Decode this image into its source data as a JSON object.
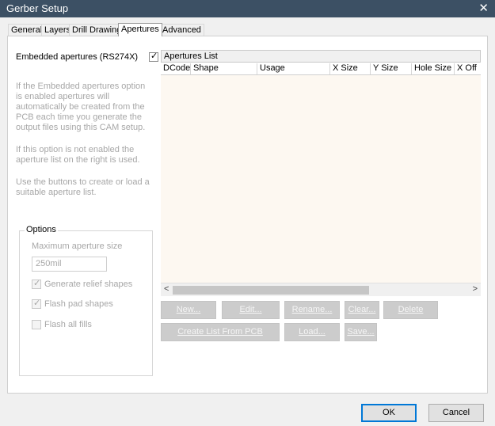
{
  "window": {
    "title": "Gerber Setup",
    "close_glyph": "✕"
  },
  "tabs": [
    {
      "label": "General"
    },
    {
      "label": "Layers"
    },
    {
      "label": "Drill Drawing"
    },
    {
      "label": "Apertures",
      "active": true
    },
    {
      "label": "Advanced"
    }
  ],
  "embedded": {
    "label": "Embedded apertures (RS274X)",
    "checked": true,
    "check_glyph": "✓"
  },
  "description": {
    "p1": "If the Embedded apertures option is enabled apertures will automatically be created from the PCB each time you generate the output files using this CAM setup.",
    "p2": "If this option is not enabled the aperture list on the right is used.",
    "p3": "Use the buttons to create or load a suitable aperture list."
  },
  "options": {
    "legend": "Options",
    "max_aperture_label": "Maximum aperture size",
    "max_aperture_value": "250mil",
    "generate_relief": {
      "label": "Generate relief shapes",
      "checked": true
    },
    "flash_pad": {
      "label": "Flash pad shapes",
      "checked": true
    },
    "flash_all": {
      "label": "Flash all fills",
      "checked": false
    }
  },
  "apertures_list": {
    "title": "Apertures List",
    "columns": [
      "DCode",
      "Shape",
      "Usage",
      "X Size",
      "Y Size",
      "Hole Size",
      "X Off"
    ],
    "rows": []
  },
  "scroll": {
    "left_arrow": "<",
    "right_arrow": ">"
  },
  "buttons": {
    "new": "New...",
    "edit": "Edit...",
    "rename": "Rename...",
    "clear": "Clear...",
    "delete": "Delete",
    "create_from_pcb": "Create List From PCB",
    "load": "Load...",
    "save": "Save..."
  },
  "dialog": {
    "ok": "OK",
    "cancel": "Cancel"
  }
}
